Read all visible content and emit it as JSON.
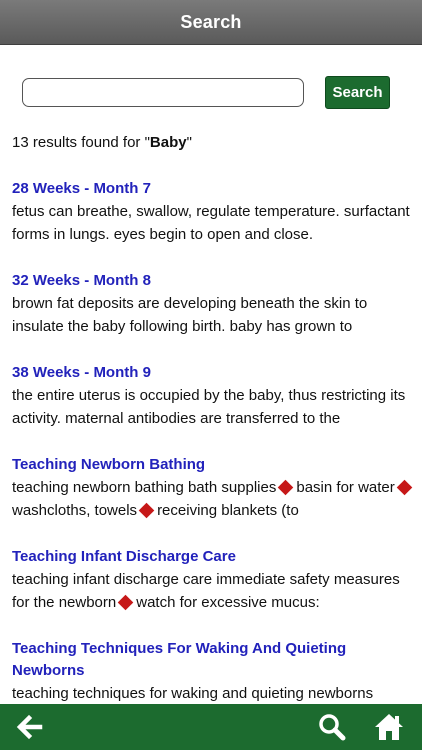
{
  "header": {
    "title": "Search"
  },
  "search": {
    "button_label": "Search",
    "value": ""
  },
  "results_summary": {
    "prefix": "13 results found for \"",
    "query": "Baby",
    "suffix": "\""
  },
  "results": [
    {
      "title": "28 Weeks - Month 7",
      "snippet_parts": [
        "fetus can breathe, swallow, regulate temperature. surfactant forms in lungs. eyes begin to open and close."
      ]
    },
    {
      "title": "32 Weeks - Month 8",
      "snippet_parts": [
        "brown fat deposits are developing beneath the skin to insulate the baby following birth. baby has grown to"
      ]
    },
    {
      "title": "38 Weeks - Month 9",
      "snippet_parts": [
        "the entire uterus is occupied by the baby, thus restricting its activity. maternal antibodies are transferred to the"
      ]
    },
    {
      "title": "Teaching Newborn Bathing",
      "snippet_parts": [
        "teaching newborn bathing bath supplies",
        "basin for water",
        "washcloths, towels",
        "receiving blankets (to"
      ]
    },
    {
      "title": "Teaching Infant Discharge Care",
      "snippet_parts": [
        "teaching infant discharge care immediate safety measures for the newborn",
        "watch for excessive mucus:"
      ]
    },
    {
      "title": "Teaching Techniques For Waking And Quieting Newborns",
      "snippet_parts": [
        "teaching techniques for waking and quieting newborns"
      ]
    }
  ],
  "bottom_nav": {
    "back": "back-arrow-icon",
    "search": "search-icon",
    "home": "home-icon"
  },
  "colors": {
    "header": "#6a6a6a",
    "accent": "#1c6b2f",
    "link": "#2222bb",
    "bullet": "#c61818"
  }
}
